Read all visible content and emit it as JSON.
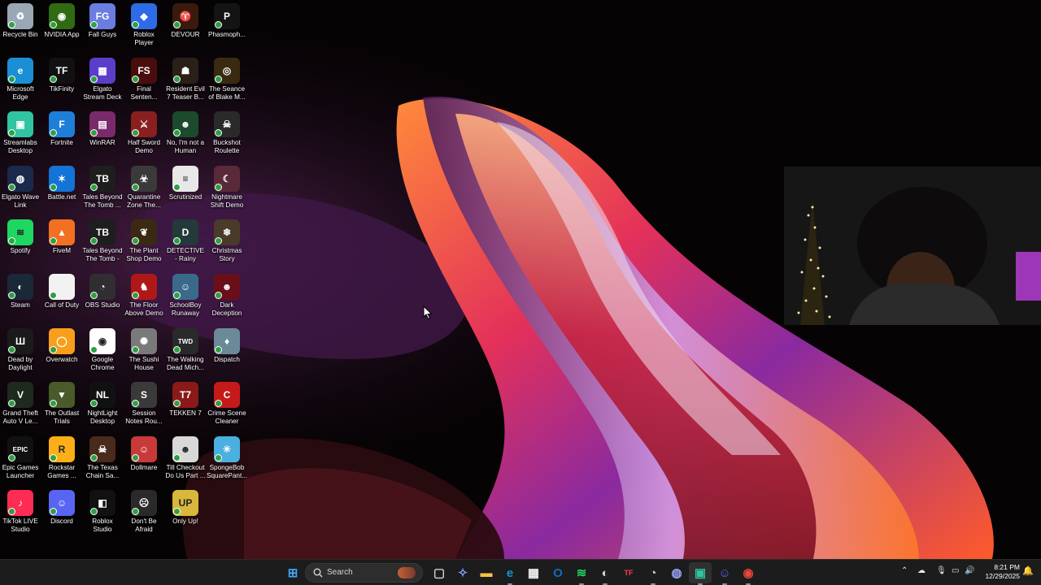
{
  "desktop": {
    "icons": [
      {
        "label": "Recycle Bin",
        "icon": "recycle-bin-icon",
        "color": "#9aa7b5",
        "glyph": "♻"
      },
      {
        "label": "NVIDIA App",
        "icon": "nvidia-icon",
        "color": "#2f6b13",
        "glyph": "◉"
      },
      {
        "label": "Fall Guys",
        "icon": "fall-guys-icon",
        "color": "#6b7de0",
        "glyph": "FG"
      },
      {
        "label": "Roblox Player",
        "icon": "roblox-icon",
        "color": "#2e6be6",
        "glyph": "◆"
      },
      {
        "label": "DEVOUR",
        "icon": "devour-icon",
        "color": "#3a1a0f",
        "glyph": "♈"
      },
      {
        "label": "Phasmoph...",
        "icon": "phasmophobia-icon",
        "color": "#141414",
        "glyph": "P"
      },
      {
        "label": "Microsoft Edge",
        "icon": "edge-icon",
        "color": "#1a8fd4",
        "glyph": "e"
      },
      {
        "label": "TikFinity",
        "icon": "tikfinity-icon",
        "color": "#111111",
        "glyph": "TF"
      },
      {
        "label": "Elgato Stream Deck",
        "icon": "stream-deck-icon",
        "color": "#5a3ec8",
        "glyph": "▦"
      },
      {
        "label": "Final Senten...",
        "icon": "final-sentence-icon",
        "color": "#4a0d0d",
        "glyph": "FS"
      },
      {
        "label": "Resident Evil 7 Teaser B...",
        "icon": "resident-evil-icon",
        "color": "#2a2018",
        "glyph": "☗"
      },
      {
        "label": "The Seance of Blake M...",
        "icon": "seance-icon",
        "color": "#3b2a12",
        "glyph": "◎"
      },
      {
        "label": "Streamlabs Desktop",
        "icon": "streamlabs-icon",
        "color": "#31c3a2",
        "glyph": "▣"
      },
      {
        "label": "Fortnite",
        "icon": "fortnite-icon",
        "color": "#1e7fd8",
        "glyph": "F"
      },
      {
        "label": "WinRAR",
        "icon": "winrar-icon",
        "color": "#7a2a6b",
        "glyph": "▤"
      },
      {
        "label": "Half Sword Demo",
        "icon": "half-sword-icon",
        "color": "#8a1f1f",
        "glyph": "⚔"
      },
      {
        "label": "No, I'm not a Human",
        "icon": "no-im-not-human-icon",
        "color": "#1c4a2c",
        "glyph": "☻"
      },
      {
        "label": "Buckshot Roulette",
        "icon": "buckshot-icon",
        "color": "#2a2a2a",
        "glyph": "☠"
      },
      {
        "label": "Elgato Wave Link",
        "icon": "wave-link-icon",
        "color": "#1b2a4a",
        "glyph": "◍"
      },
      {
        "label": "Battle.net",
        "icon": "battlenet-icon",
        "color": "#1473d6",
        "glyph": "✶"
      },
      {
        "label": "Tales Beyond The Tomb ...",
        "icon": "tbtt-ep3-icon",
        "color": "#1e1e1e",
        "glyph": "TB"
      },
      {
        "label": "Quarantine Zone The...",
        "icon": "quarantine-zone-icon",
        "color": "#3a3a3a",
        "glyph": "☣"
      },
      {
        "label": "Scrutinized",
        "icon": "scrutinized-icon",
        "color": "#e8e8e8",
        "glyph": "≡"
      },
      {
        "label": "Nightmare Shift Demo",
        "icon": "nightmare-shift-icon",
        "color": "#5a2a3a",
        "glyph": "☾"
      },
      {
        "label": "Spotify",
        "icon": "spotify-icon",
        "color": "#1ed760",
        "glyph": "≋"
      },
      {
        "label": "FiveM",
        "icon": "fivem-icon",
        "color": "#f27022",
        "glyph": "▲"
      },
      {
        "label": "Tales Beyond The Tomb - ...",
        "icon": "tbtt-ep4-icon",
        "color": "#1e1e1e",
        "glyph": "TB"
      },
      {
        "label": "The Plant Shop Demo",
        "icon": "plant-shop-icon",
        "color": "#3a2a14",
        "glyph": "❦"
      },
      {
        "label": "DETECTIVE - Rainy nigh...",
        "icon": "detective-icon",
        "color": "#243a3a",
        "glyph": "D"
      },
      {
        "label": "Christmas Story",
        "icon": "christmas-story-icon",
        "color": "#4a3a2a",
        "glyph": "❄"
      },
      {
        "label": "Steam",
        "icon": "steam-icon",
        "color": "#1b2838",
        "glyph": "◐"
      },
      {
        "label": "Call of Duty",
        "icon": "call-of-duty-icon",
        "color": "#f2f2f2",
        "glyph": ""
      },
      {
        "label": "OBS Studio",
        "icon": "obs-icon",
        "color": "#302e31",
        "glyph": "◔"
      },
      {
        "label": "The Floor Above Demo",
        "icon": "floor-above-icon",
        "color": "#b01818",
        "glyph": "♞"
      },
      {
        "label": "SchoolBoy Runaway",
        "icon": "schoolboy-icon",
        "color": "#3a6a8a",
        "glyph": "☺"
      },
      {
        "label": "Dark Deception",
        "icon": "dark-deception-icon",
        "color": "#6a0f1a",
        "glyph": "☻"
      },
      {
        "label": "Dead by Daylight",
        "icon": "dead-by-daylight-icon",
        "color": "#1a1a1a",
        "glyph": "Ш"
      },
      {
        "label": "Overwatch",
        "icon": "overwatch-icon",
        "color": "#f99e1a",
        "glyph": "◯"
      },
      {
        "label": "Google Chrome",
        "icon": "chrome-icon",
        "color": "#ffffff",
        "glyph": "◉"
      },
      {
        "label": "The Sushi House",
        "icon": "sushi-house-icon",
        "color": "#7a7a7a",
        "glyph": "✺"
      },
      {
        "label": "The Walking Dead Mich...",
        "icon": "walking-dead-icon",
        "color": "#2a2a2a",
        "glyph": "TWD"
      },
      {
        "label": "Dispatch",
        "icon": "dispatch-icon",
        "color": "#6a8a9a",
        "glyph": "♦"
      },
      {
        "label": "Grand Theft Auto V Le...",
        "icon": "gta-v-icon",
        "color": "#1e2a1e",
        "glyph": "V"
      },
      {
        "label": "The Outlast Trials",
        "icon": "outlast-trials-icon",
        "color": "#4a5a2a",
        "glyph": "▼"
      },
      {
        "label": "NightLight Desktop",
        "icon": "nightlight-icon",
        "color": "#111111",
        "glyph": "NL"
      },
      {
        "label": "Session Notes Rou...",
        "icon": "session-notes-icon",
        "color": "#3a3a3a",
        "glyph": "S"
      },
      {
        "label": "TEKKEN 7",
        "icon": "tekken-icon",
        "color": "#8a1a1a",
        "glyph": "T7"
      },
      {
        "label": "Crime Scene Cleaner",
        "icon": "crime-scene-icon",
        "color": "#c41a1a",
        "glyph": "C"
      },
      {
        "label": "Epic Games Launcher",
        "icon": "epic-games-icon",
        "color": "#111111",
        "glyph": "EPIC"
      },
      {
        "label": "Rockstar Games ...",
        "icon": "rockstar-icon",
        "color": "#fcaf17",
        "glyph": "R"
      },
      {
        "label": "The Texas Chain Sa...",
        "icon": "texas-chainsaw-icon",
        "color": "#4a2a1a",
        "glyph": "☠"
      },
      {
        "label": "Dollmare",
        "icon": "dollmare-icon",
        "color": "#c83a3a",
        "glyph": "☺"
      },
      {
        "label": "Till Checkout Do Us Part ...",
        "icon": "till-checkout-icon",
        "color": "#d8d8d8",
        "glyph": "☻"
      },
      {
        "label": "SpongeBob SquarePant...",
        "icon": "spongebob-icon",
        "color": "#4ab0e0",
        "glyph": "☀"
      },
      {
        "label": "TikTok LIVE Studio",
        "icon": "tiktok-live-icon",
        "color": "#fe2c55",
        "glyph": "♪"
      },
      {
        "label": "Discord",
        "icon": "discord-icon",
        "color": "#5865f2",
        "glyph": "☺"
      },
      {
        "label": "Roblox Studio",
        "icon": "roblox-studio-icon",
        "color": "#111111",
        "glyph": "◧"
      },
      {
        "label": "Don't Be Afraid",
        "icon": "dont-be-afraid-icon",
        "color": "#2a2a2a",
        "glyph": "☹"
      },
      {
        "label": "Only Up!",
        "icon": "only-up-icon",
        "color": "#d8b83a",
        "glyph": "UP"
      }
    ]
  },
  "taskbar": {
    "search_placeholder": "Search",
    "apps": [
      {
        "name": "start-button",
        "icon": "windows-start-icon",
        "color": "#3fa9f5",
        "glyph": "⊞"
      },
      {
        "name": "taskbar-task-view",
        "icon": "task-view-icon",
        "color": "#cfcfcf",
        "glyph": "▢"
      },
      {
        "name": "taskbar-copilot",
        "icon": "copilot-icon",
        "color": "#7aa0ff",
        "glyph": "✧"
      },
      {
        "name": "taskbar-file-explorer",
        "icon": "folder-icon",
        "color": "#f6c443",
        "glyph": "▬"
      },
      {
        "name": "taskbar-edge",
        "icon": "edge-icon",
        "color": "#1a8fd4",
        "glyph": "e"
      },
      {
        "name": "taskbar-store",
        "icon": "store-icon",
        "color": "#f3f3f3",
        "glyph": "▦"
      },
      {
        "name": "taskbar-outlook",
        "icon": "outlook-icon",
        "color": "#0f6cbd",
        "glyph": "O"
      },
      {
        "name": "taskbar-spotify",
        "icon": "spotify-icon",
        "color": "#1ed760",
        "glyph": "≋"
      },
      {
        "name": "taskbar-steam",
        "icon": "steam-icon",
        "color": "#c7d5e0",
        "glyph": "◐"
      },
      {
        "name": "taskbar-tikfinity",
        "icon": "tikfinity-icon",
        "color": "#ff3b5c",
        "glyph": "TF"
      },
      {
        "name": "taskbar-obs",
        "icon": "obs-icon",
        "color": "#cfcfcf",
        "glyph": "◔"
      },
      {
        "name": "taskbar-wave-link",
        "icon": "wave-link-icon",
        "color": "#9aa8ff",
        "glyph": "◍"
      },
      {
        "name": "taskbar-streamlabs",
        "icon": "streamlabs-icon",
        "color": "#31c3a2",
        "glyph": "▣"
      },
      {
        "name": "taskbar-discord",
        "icon": "discord-icon",
        "color": "#5865f2",
        "glyph": "☺"
      },
      {
        "name": "taskbar-chrome",
        "icon": "chrome-icon",
        "color": "#e8453c",
        "glyph": "◉"
      }
    ],
    "tray": {
      "time": "8:21 PM",
      "date": "12/29/2025"
    }
  }
}
